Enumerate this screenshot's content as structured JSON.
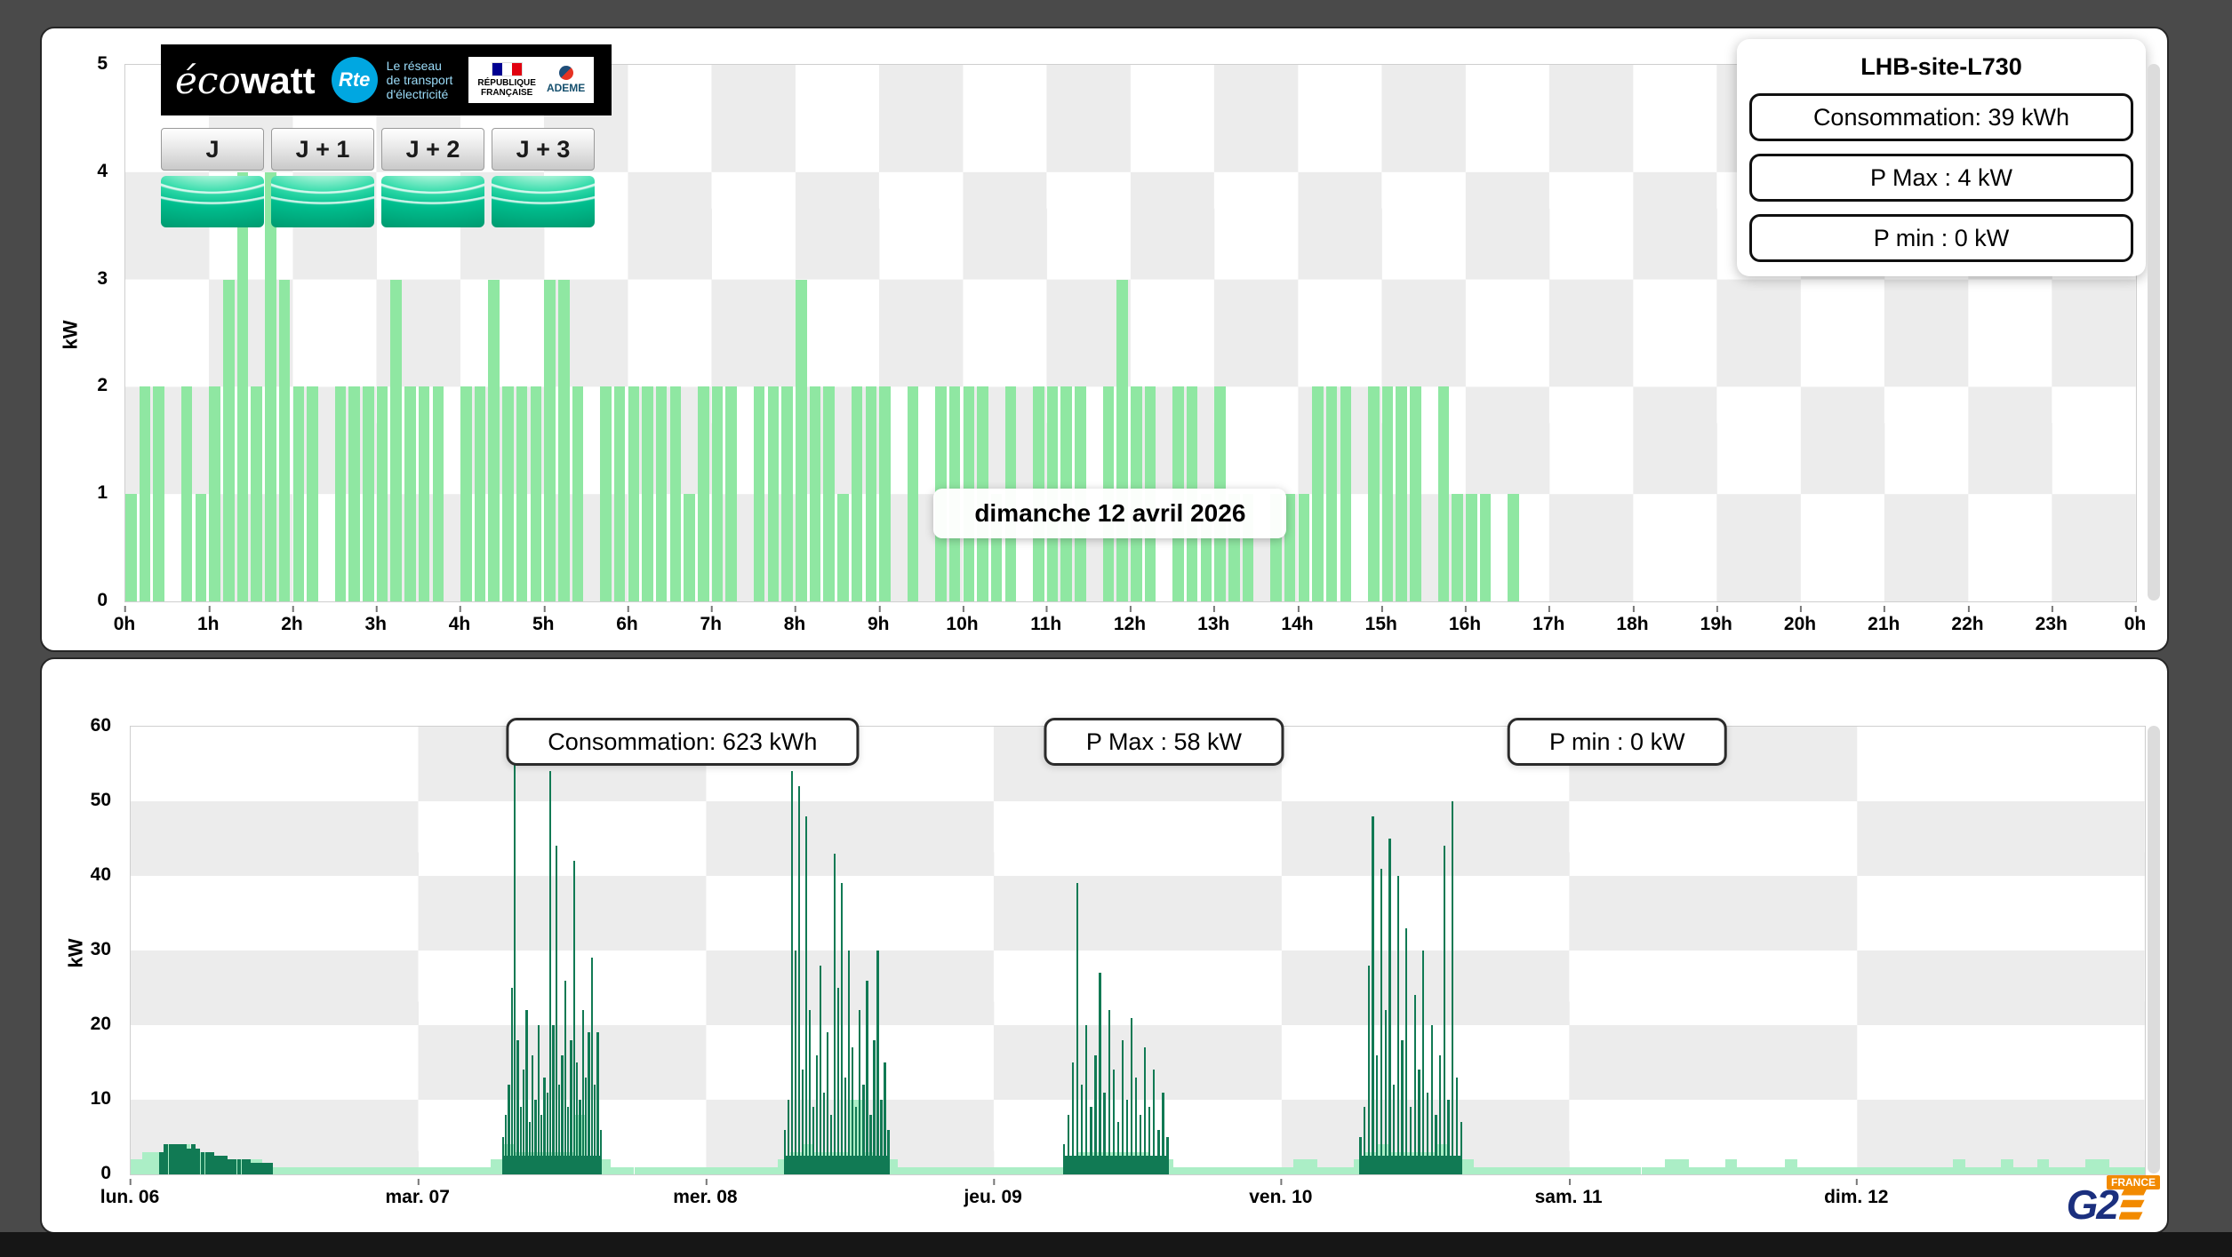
{
  "header": {
    "ecowatt": {
      "eco": "éco",
      "watt": "watt"
    },
    "rte": {
      "abbr": "Rte",
      "color": "#00a7e1",
      "tagline1": "Le réseau",
      "tagline2": "de transport",
      "tagline3": "d'électricité"
    },
    "gov": {
      "line1": "RÉPUBLIQUE",
      "line2": "FRANÇAISE"
    },
    "ademe": {
      "label": "ADEME"
    }
  },
  "tabs": [
    {
      "label": "J"
    },
    {
      "label": "J + 1"
    },
    {
      "label": "J + 2"
    },
    {
      "label": "J + 3"
    }
  ],
  "footer_logo": {
    "g2": "G2",
    "france": "FRANCE",
    "blue": "#1b2f7e",
    "orange": "#f28a00"
  },
  "chart_data": [
    {
      "type": "bar",
      "title": "dimanche 12 avril 2026",
      "ylabel": "kW",
      "ylim": [
        0,
        5
      ],
      "yticks": [
        0,
        1,
        2,
        3,
        4,
        5
      ],
      "x_tick_labels": [
        "0h",
        "1h",
        "2h",
        "3h",
        "4h",
        "5h",
        "6h",
        "7h",
        "8h",
        "9h",
        "10h",
        "11h",
        "12h",
        "13h",
        "14h",
        "15h",
        "16h",
        "17h",
        "18h",
        "19h",
        "20h",
        "21h",
        "22h",
        "23h",
        "0h"
      ],
      "step_minutes": 10,
      "bar_color": "#8fe7a2",
      "annotations": {
        "site": "LHB-site-L730",
        "consumption": "Consommation: 39 kWh",
        "pmax": "P Max :  4 kW",
        "pmin": "P min : 0 kW"
      },
      "values": [
        1,
        2,
        2,
        0,
        2,
        1,
        2,
        3,
        4,
        2,
        4,
        3,
        2,
        2,
        0,
        2,
        2,
        2,
        2,
        3,
        2,
        2,
        2,
        0,
        2,
        2,
        3,
        2,
        2,
        2,
        3,
        3,
        2,
        0,
        2,
        2,
        2,
        2,
        2,
        2,
        1,
        2,
        2,
        2,
        0,
        2,
        2,
        2,
        3,
        2,
        2,
        1,
        2,
        2,
        2,
        0,
        2,
        0,
        2,
        2,
        2,
        2,
        1,
        2,
        0,
        2,
        2,
        2,
        2,
        0,
        2,
        3,
        2,
        2,
        0,
        2,
        2,
        1,
        2,
        1,
        1,
        0,
        1,
        1,
        1,
        2,
        2,
        2,
        0,
        2,
        2,
        2,
        2,
        0,
        2,
        1,
        1,
        1,
        0,
        1,
        0,
        0,
        0,
        0,
        0,
        0,
        0,
        0,
        0,
        0,
        0,
        0,
        0,
        0,
        0,
        0,
        0,
        0,
        0,
        0,
        0,
        0,
        0,
        0,
        0,
        0,
        0,
        0,
        0,
        0,
        0,
        0,
        0,
        0,
        0,
        0,
        0,
        0,
        0,
        0,
        0,
        0,
        0,
        0
      ]
    },
    {
      "type": "bar",
      "ylabel": "kW",
      "ylim": [
        0,
        60
      ],
      "yticks": [
        0,
        10,
        20,
        30,
        40,
        50,
        60
      ],
      "x_tick_labels": [
        "lun. 06",
        "mar. 07",
        "mer. 08",
        "jeu. 09",
        "ven. 10",
        "sam. 11",
        "dim. 12"
      ],
      "step_minutes": 60,
      "light_color": "#abeec6",
      "dark_color": "#117a54",
      "annotations": {
        "consumption": "Consommation: 623 kWh",
        "pmax": "P Max :  58 kW",
        "pmin": "P min : 0 kW"
      },
      "light_hourly": [
        2,
        3,
        3,
        4,
        4,
        3,
        3,
        2,
        2,
        2,
        2,
        1,
        1,
        1,
        1,
        1,
        1,
        1,
        1,
        1,
        1,
        1,
        1,
        1,
        1,
        1,
        1,
        1,
        1,
        1,
        2,
        4,
        3,
        3,
        3,
        3,
        3,
        8,
        2,
        2,
        1,
        1,
        1,
        1,
        1,
        1,
        1,
        1,
        1,
        1,
        1,
        1,
        1,
        1,
        2,
        3,
        4,
        3,
        3,
        3,
        10,
        3,
        2,
        2,
        1,
        1,
        1,
        1,
        1,
        1,
        1,
        1,
        1,
        1,
        1,
        1,
        1,
        1,
        2,
        3,
        3,
        3,
        3,
        3,
        3,
        2,
        2,
        1,
        1,
        1,
        1,
        1,
        1,
        1,
        1,
        1,
        1,
        2,
        2,
        1,
        1,
        1,
        2,
        3,
        4,
        3,
        3,
        3,
        3,
        4,
        2,
        2,
        1,
        1,
        1,
        1,
        1,
        1,
        1,
        1,
        1,
        1,
        1,
        1,
        1,
        1,
        1,
        1,
        2,
        2,
        1,
        1,
        1,
        2,
        1,
        1,
        1,
        1,
        2,
        1,
        1,
        1,
        1,
        1,
        1,
        1,
        1,
        1,
        1,
        1,
        1,
        1,
        2,
        1,
        1,
        1,
        2,
        1,
        1,
        2,
        1,
        1,
        1,
        2,
        2,
        1,
        1,
        1
      ],
      "dark_clusters": [
        {
          "start": 0.1,
          "end": 0.48,
          "base": 0,
          "wide": true,
          "spikes": [
            3,
            4,
            4,
            4,
            4,
            4,
            3.5,
            4,
            3.5,
            3,
            3,
            3,
            2.5,
            2.5,
            2.5,
            2,
            2,
            2,
            2,
            2,
            1.5,
            1.5,
            1.5,
            1.5,
            1.5
          ]
        },
        {
          "start": 1.29,
          "end": 1.63,
          "base": 2.5,
          "spikes": [
            5,
            8,
            12,
            25,
            55,
            18,
            9,
            14,
            22,
            7,
            16,
            10,
            20,
            8,
            13,
            11,
            54,
            20,
            44,
            12,
            16,
            26,
            9,
            18,
            42,
            15,
            10,
            22,
            13,
            19,
            29,
            12,
            19,
            6
          ]
        },
        {
          "start": 2.27,
          "end": 2.63,
          "base": 2.5,
          "spikes": [
            6,
            10,
            54,
            30,
            52,
            14,
            48,
            22,
            9,
            16,
            28,
            11,
            19,
            8,
            43,
            25,
            39,
            13,
            30,
            17,
            9,
            22,
            12,
            26,
            8,
            18,
            30,
            10,
            15,
            6
          ]
        },
        {
          "start": 3.24,
          "end": 3.6,
          "base": 2.5,
          "spikes": [
            4,
            8,
            15,
            39,
            12,
            20,
            9,
            16,
            27,
            11,
            22,
            14,
            7,
            18,
            10,
            21,
            13,
            8,
            17,
            9,
            14,
            6,
            11,
            5
          ]
        },
        {
          "start": 4.27,
          "end": 4.62,
          "base": 2.5,
          "spikes": [
            5,
            9,
            28,
            48,
            16,
            41,
            22,
            45,
            12,
            40,
            18,
            33,
            9,
            24,
            14,
            30,
            11,
            20,
            8,
            16,
            44,
            10,
            50,
            13,
            7
          ]
        }
      ]
    }
  ]
}
